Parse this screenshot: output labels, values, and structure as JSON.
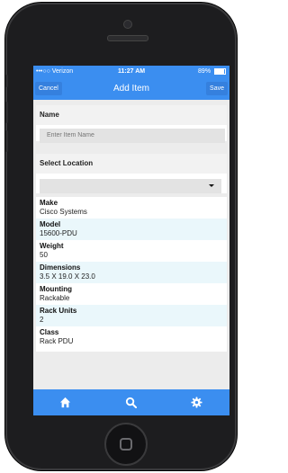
{
  "status_bar": {
    "carrier": "•••○○ Verizon",
    "time": "11:27 AM",
    "battery": "89%",
    "battery_level": 0.89
  },
  "nav": {
    "cancel_label": "Cancel",
    "title": "Add Item",
    "save_label": "Save"
  },
  "name_section": {
    "label": "Name",
    "placeholder": "Enter Item Name",
    "value": ""
  },
  "location_section": {
    "label": "Select Location",
    "selected": ""
  },
  "details": [
    {
      "label": "Make",
      "value": "Cisco Systems"
    },
    {
      "label": "Model",
      "value": "15600-PDU"
    },
    {
      "label": "Weight",
      "value": "50"
    },
    {
      "label": "Dimensions",
      "value": "3.5 X 19.0 X 23.0"
    },
    {
      "label": "Mounting",
      "value": "Rackable"
    },
    {
      "label": "Rack Units",
      "value": "2"
    },
    {
      "label": "Class",
      "value": "Rack PDU"
    }
  ],
  "tab_bar": {
    "tabs": [
      {
        "icon": "home-icon"
      },
      {
        "icon": "search-icon"
      },
      {
        "icon": "gear-icon"
      }
    ]
  },
  "colors": {
    "accent": "#3b8ef0",
    "detail_shade": "#eaf7fb",
    "phone_body": "#1d1d1f"
  }
}
